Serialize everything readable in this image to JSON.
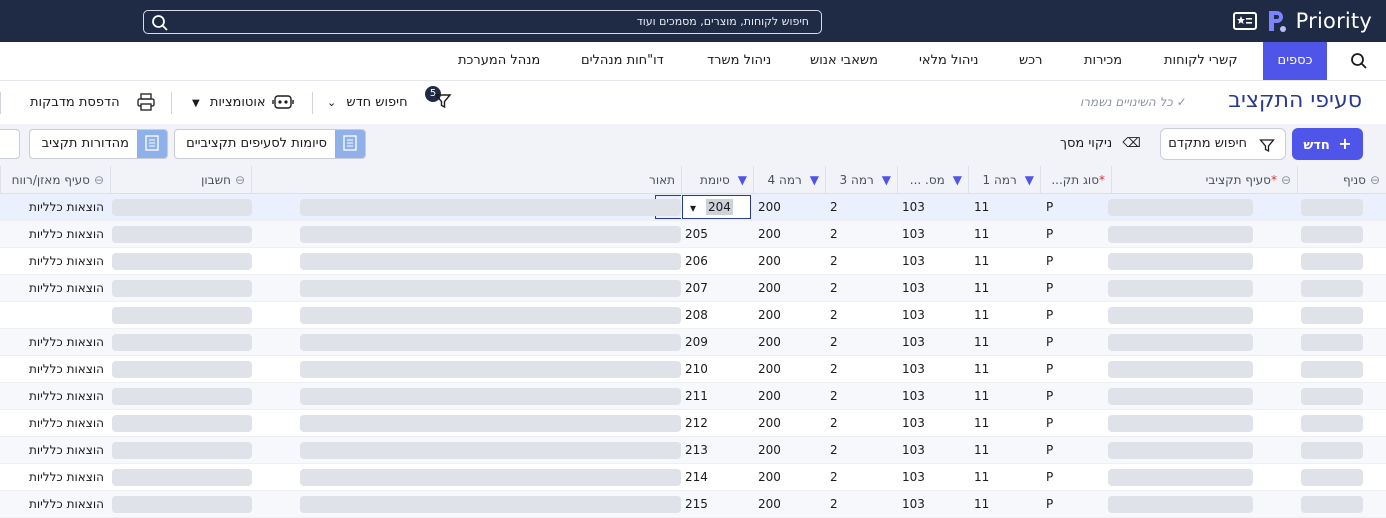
{
  "app": {
    "brand": "Priority",
    "search_placeholder": "חיפוש לקוחות, מוצרים, מסמכים ועוד"
  },
  "menu": [
    {
      "label": "כספים",
      "active": true
    },
    {
      "label": "קשרי לקוחות"
    },
    {
      "label": "מכירות"
    },
    {
      "label": "רכש"
    },
    {
      "label": "ניהול מלאי"
    },
    {
      "label": "משאבי אנוש"
    },
    {
      "label": "ניהול משרד"
    },
    {
      "label": "דו\"חות מנהלים"
    },
    {
      "label": "מנהל המערכת"
    }
  ],
  "page": {
    "title": "סעיפי התקציב",
    "saved_status": "כל השינויים נשמרו",
    "filter_count": "5",
    "new_search": "חיפוש חדש",
    "automations": "אוטומציות",
    "print_labels": "הדפסת מדבקות"
  },
  "actions": {
    "new": "חדש",
    "advanced_search": "חיפוש מתקדם",
    "clear_screen": "ניקוי מסך",
    "budget_suffixes": "סיומות לסעיפים תקציביים",
    "budget_versions": "מהדורות תקציב"
  },
  "columns": {
    "branch": "סניף",
    "budget_item": "סעיף תקציבי",
    "budget_type": "סוג תק...",
    "level1": "רמה 1",
    "num": "מס. ...",
    "level3": "רמה 3",
    "level4": "רמה 4",
    "suffix": "סיומת",
    "description": "תאור",
    "account": "חשבון",
    "balance_item": "סעיף מאזן/רווח"
  },
  "rows": [
    {
      "type": "P",
      "level1": "11",
      "num": "103",
      "level3": "2",
      "level4": "200",
      "suffix": "204",
      "balance": "הוצאות כלליות"
    },
    {
      "type": "P",
      "level1": "11",
      "num": "103",
      "level3": "2",
      "level4": "200",
      "suffix": "205",
      "balance": "הוצאות כלליות"
    },
    {
      "type": "P",
      "level1": "11",
      "num": "103",
      "level3": "2",
      "level4": "200",
      "suffix": "206",
      "balance": "הוצאות כלליות"
    },
    {
      "type": "P",
      "level1": "11",
      "num": "103",
      "level3": "2",
      "level4": "200",
      "suffix": "207",
      "balance": "הוצאות כלליות"
    },
    {
      "type": "P",
      "level1": "11",
      "num": "103",
      "level3": "2",
      "level4": "200",
      "suffix": "208",
      "balance": ""
    },
    {
      "type": "P",
      "level1": "11",
      "num": "103",
      "level3": "2",
      "level4": "200",
      "suffix": "209",
      "balance": "הוצאות כלליות"
    },
    {
      "type": "P",
      "level1": "11",
      "num": "103",
      "level3": "2",
      "level4": "200",
      "suffix": "210",
      "balance": "הוצאות כלליות"
    },
    {
      "type": "P",
      "level1": "11",
      "num": "103",
      "level3": "2",
      "level4": "200",
      "suffix": "211",
      "balance": "הוצאות כלליות"
    },
    {
      "type": "P",
      "level1": "11",
      "num": "103",
      "level3": "2",
      "level4": "200",
      "suffix": "212",
      "balance": "הוצאות כלליות"
    },
    {
      "type": "P",
      "level1": "11",
      "num": "103",
      "level3": "2",
      "level4": "200",
      "suffix": "213",
      "balance": "הוצאות כלליות"
    },
    {
      "type": "P",
      "level1": "11",
      "num": "103",
      "level3": "2",
      "level4": "200",
      "suffix": "214",
      "balance": "הוצאות כלליות"
    },
    {
      "type": "P",
      "level1": "11",
      "num": "103",
      "level3": "2",
      "level4": "200",
      "suffix": "215",
      "balance": "הוצאות כלליות"
    }
  ]
}
